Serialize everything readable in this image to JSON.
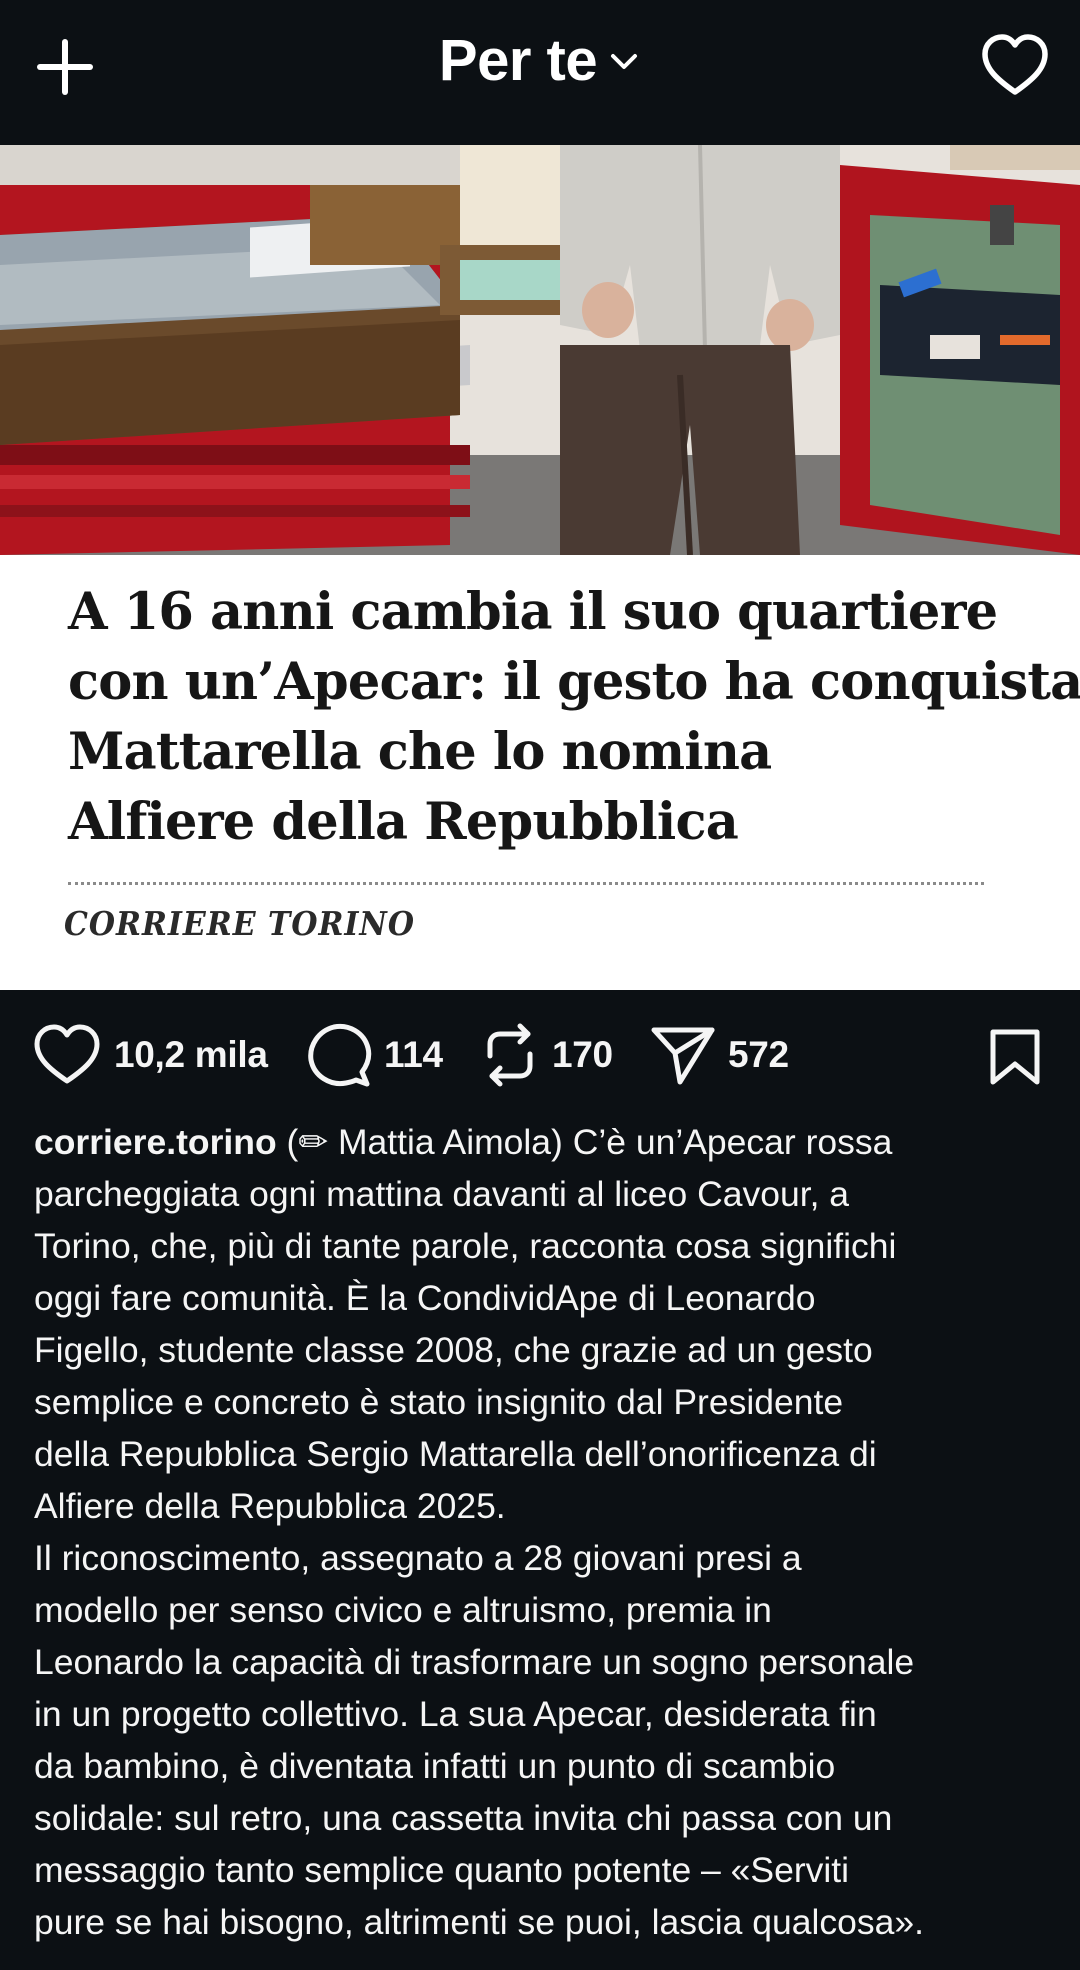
{
  "header": {
    "title": "Per te"
  },
  "post": {
    "headline_lines": [
      "A 16 anni cambia il suo quartiere",
      "con un’Apecar: il gesto ha conquistato",
      "Mattarella che lo nomina",
      "Alfiere della Repubblica"
    ],
    "masthead": "CORRIERE TORINO",
    "counts": {
      "likes": "10,2 mila",
      "comments": "114",
      "reposts": "170",
      "shares": "572"
    },
    "caption": {
      "username": "corriere.torino",
      "first_line_rest": " (✏ Mattia Aimola) C’è un’Apecar rossa",
      "lines": [
        "parcheggiata ogni mattina davanti al liceo Cavour, a",
        "Torino, che, più di tante parole, racconta cosa significhi",
        "oggi fare comunità. È la CondividApe di Leonardo",
        "Figello, studente classe 2008, che grazie ad un gesto",
        "semplice e concreto è stato insignito dal Presidente",
        "della Repubblica Sergio Mattarella dell’onorificenza di",
        "Alfiere della Repubblica 2025.",
        "Il riconoscimento, assegnato a 28 giovani presi a",
        "modello per senso civico e altruismo, premia in",
        "Leonardo la capacità di trasformare un sogno personale",
        "in un progetto collettivo. La sua Apecar, desiderata fin",
        "da bambino, è diventata infatti un punto di scambio",
        "solidale: sul retro, una cassetta invita chi passa con un",
        "messaggio tanto semplice quanto potente – «Serviti",
        "pure se hai bisogno, altrimenti se puoi, lascia qualcosa»."
      ]
    }
  },
  "icons": {
    "create": "plus-icon",
    "feed_dropdown": "chevron-down-icon",
    "notifications": "heart-icon",
    "like": "heart-icon",
    "comment": "comment-bubble-icon",
    "repost": "repost-icon",
    "share": "paper-plane-icon",
    "save": "bookmark-icon"
  },
  "colors": {
    "background": "#0c1014",
    "text": "#f5f5f5",
    "card": "#ffffff",
    "headline": "#161616",
    "apecar_red": "#a5121c"
  }
}
